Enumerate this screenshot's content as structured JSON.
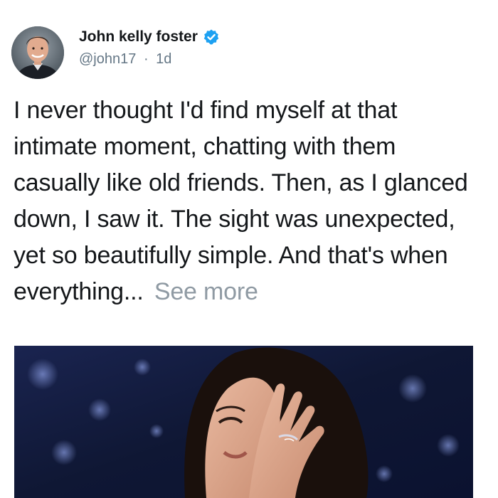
{
  "tweet": {
    "author": {
      "display_name": "John kelly foster",
      "handle": "@john17",
      "verified": true,
      "avatar_icon": "profile-photo"
    },
    "separator": "·",
    "timestamp": "1d",
    "text": "I never thought I'd find myself at that intimate moment, chatting with them casually like old friends. Then, as I glanced down, I saw it. The sight was unexpected, yet so beautifully simple. And that's when everything...",
    "see_more_label": "See more",
    "media": {
      "type": "photo"
    }
  },
  "colors": {
    "verified_badge": "#1da1f2",
    "secondary_text": "#657786",
    "see_more": "#8f9aa3",
    "primary_text": "#14171a"
  }
}
